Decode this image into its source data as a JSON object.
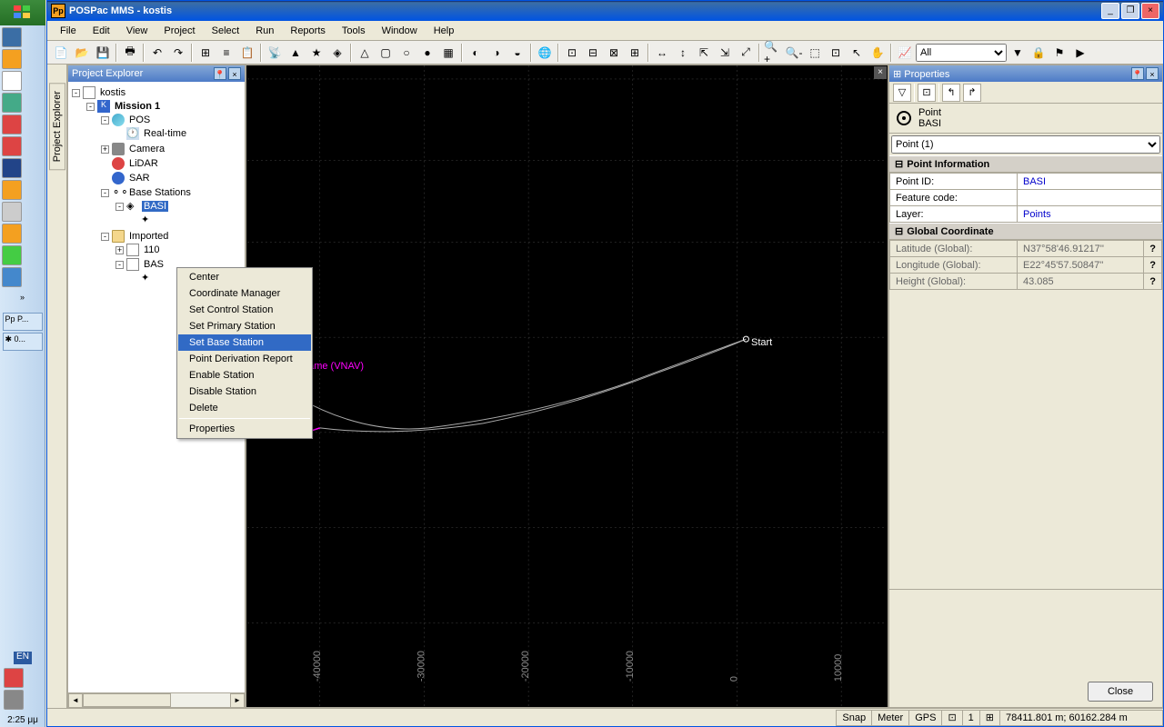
{
  "taskbar": {
    "lang": "EN",
    "time": "2:25 μμ",
    "running": [
      "Pp P...",
      "✱ 0..."
    ]
  },
  "titlebar": {
    "app_icon": "Pp",
    "title": "POSPac MMS - kostis"
  },
  "menu": [
    "File",
    "Edit",
    "View",
    "Project",
    "Select",
    "Run",
    "Reports",
    "Tools",
    "Window",
    "Help"
  ],
  "toolbar_combo": "All",
  "explorer": {
    "title": "Project Explorer",
    "root": "kostis",
    "mission": "Mission 1",
    "pos": "POS",
    "realtime": "Real-time",
    "camera": "Camera",
    "lidar": "LiDAR",
    "sar": "SAR",
    "base_stations": "Base Stations",
    "basi": "BASI",
    "imported": "Imported",
    "n110": "110",
    "bas": "BAS"
  },
  "context_menu": {
    "items": [
      "Center",
      "Coordinate Manager",
      "Set Control Station",
      "Set Primary Station",
      "Set Base Station",
      "Point Derivation Report",
      "Enable Station",
      "Disable Station",
      "Delete"
    ],
    "sep_after": [
      8
    ],
    "last": "Properties",
    "selected_index": 4
  },
  "canvas": {
    "vnav_label": "e Vehicle Frame (VNAV)",
    "start_label": "Start",
    "x_ticks": [
      "-40000",
      "-30000",
      "-20000",
      "-10000",
      "0",
      "10000"
    ]
  },
  "properties": {
    "title": "Properties",
    "point_label": "Point",
    "point_name": "BASI",
    "combo": "Point (1)",
    "section1": "Point Information",
    "point_id_lbl": "Point ID:",
    "point_id_val": "BASI",
    "feature_lbl": "Feature code:",
    "feature_val": "",
    "layer_lbl": "Layer:",
    "layer_val": "Points",
    "section2": "Global Coordinate",
    "lat_lbl": "Latitude (Global):",
    "lat_val": "N37°58'46.91217''",
    "lon_lbl": "Longitude (Global):",
    "lon_val": "E22°45'57.50847''",
    "hgt_lbl": "Height (Global):",
    "hgt_val": "43.085",
    "close_btn": "Close"
  },
  "statusbar": {
    "snap": "Snap",
    "meter": "Meter",
    "gps": "GPS",
    "one": "1",
    "coords": "78411.801 m; 60162.284 m"
  }
}
